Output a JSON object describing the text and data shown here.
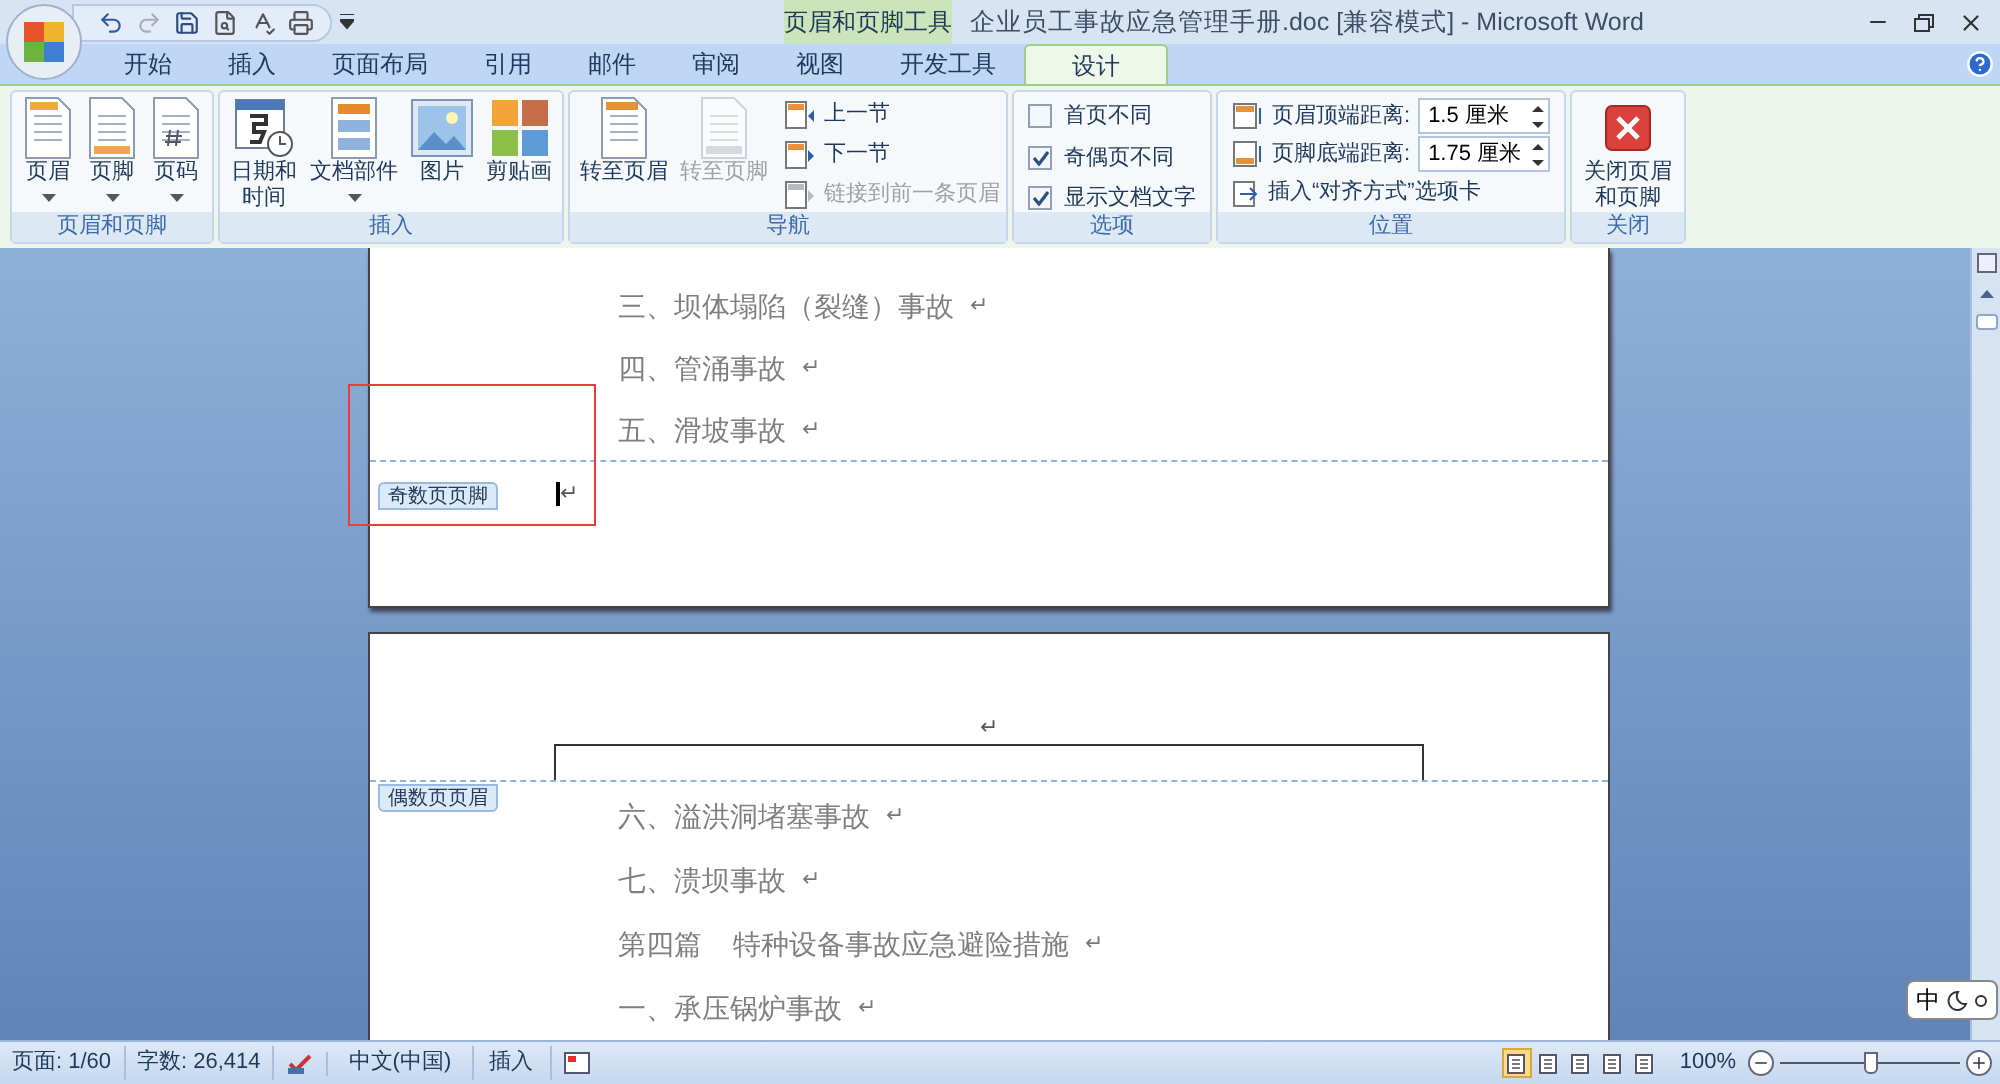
{
  "title_bar": {
    "context_group": "页眉和页脚工具",
    "title": "企业员工事故应急管理手册.doc [兼容模式] - Microsoft Word"
  },
  "tabs": [
    {
      "label": "开始",
      "selected": false
    },
    {
      "label": "插入",
      "selected": false
    },
    {
      "label": "页面布局",
      "selected": false
    },
    {
      "label": "引用",
      "selected": false
    },
    {
      "label": "邮件",
      "selected": false
    },
    {
      "label": "审阅",
      "selected": false
    },
    {
      "label": "视图",
      "selected": false
    },
    {
      "label": "开发工具",
      "selected": false
    },
    {
      "label": "设计",
      "selected": true
    }
  ],
  "ribbon_groups": [
    {
      "label": "页眉和页脚",
      "items": [
        {
          "kind": "large",
          "label": "页眉",
          "dropdown": true
        },
        {
          "kind": "large",
          "label": "页脚",
          "dropdown": true
        },
        {
          "kind": "large",
          "label": "页码",
          "dropdown": true
        }
      ]
    },
    {
      "label": "插入",
      "items": [
        {
          "kind": "large",
          "label": "日期和时间",
          "dropdown": false
        },
        {
          "kind": "large",
          "label": "文档部件",
          "dropdown": true
        },
        {
          "kind": "large",
          "label": "图片",
          "dropdown": false
        },
        {
          "kind": "large",
          "label": "剪贴画",
          "dropdown": false
        }
      ]
    },
    {
      "label": "导航",
      "items": [
        {
          "kind": "large",
          "label": "转至页眉",
          "disabled": false
        },
        {
          "kind": "large",
          "label": "转至页脚",
          "disabled": true
        },
        {
          "kind": "stack",
          "items": [
            {
              "label": "上一节",
              "disabled": false
            },
            {
              "label": "下一节",
              "disabled": false
            },
            {
              "label": "链接到前一条页眉",
              "disabled": true
            }
          ]
        }
      ]
    },
    {
      "label": "选项",
      "items": [
        {
          "kind": "checks",
          "items": [
            {
              "label": "首页不同",
              "checked": false
            },
            {
              "label": "奇偶页不同",
              "checked": true
            },
            {
              "label": "显示文档文字",
              "checked": true
            }
          ]
        }
      ]
    },
    {
      "label": "位置",
      "items": [
        {
          "kind": "position",
          "spinners": [
            {
              "label": "页眉顶端距离:",
              "value": "1.5 厘米"
            },
            {
              "label": "页脚底端距离:",
              "value": "1.75 厘米"
            }
          ],
          "link": "插入“对齐方式”选项卡"
        }
      ]
    },
    {
      "label": "关闭",
      "items": [
        {
          "kind": "large",
          "label": "关闭页眉和页脚"
        }
      ]
    }
  ],
  "pages": [
    {
      "lines": [
        {
          "text": "三、坝体塌陷（裂缝）事故",
          "mark": "↵"
        },
        {
          "text": "四、管涌事故",
          "mark": "↵"
        },
        {
          "text": "五、滑坡事故",
          "mark": "↵"
        }
      ],
      "footer_tag": "奇数页页脚",
      "footer_mark": "↵"
    },
    {
      "header_mark": "↵",
      "header_tag": "偶数页页眉",
      "lines": [
        {
          "text": "六、溢洪洞堵塞事故",
          "mark": "↵"
        },
        {
          "text": "七、溃坝事故",
          "mark": "↵"
        },
        {
          "text": "第四篇    特种设备事故应急避险措施",
          "mark": "↵"
        },
        {
          "text": "一、承压锅炉事故",
          "mark": "↵"
        }
      ]
    }
  ],
  "ime": "中",
  "status_bar": {
    "page": "页面: 1/60",
    "words": "字数: 26,414",
    "language": "中文(中国)",
    "mode": "插入",
    "views": [
      {
        "selected": true
      },
      {
        "selected": false
      },
      {
        "selected": false
      },
      {
        "selected": false
      },
      {
        "selected": false
      }
    ],
    "zoom": "100%",
    "zoom_slider": {
      "level": 0.5
    }
  }
}
